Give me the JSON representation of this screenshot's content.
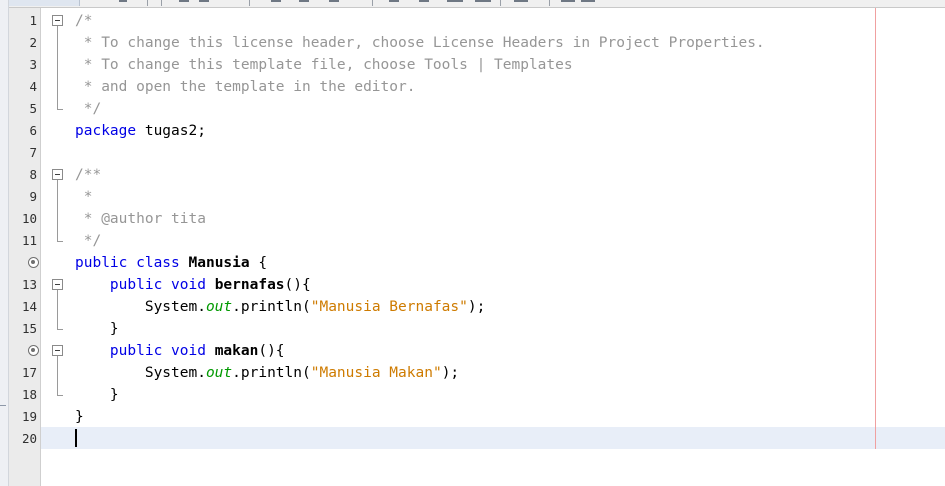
{
  "editor": {
    "line_numbers": [
      "1",
      "2",
      "3",
      "4",
      "5",
      "6",
      "7",
      "8",
      "9",
      "10",
      "11",
      "",
      "13",
      "14",
      "15",
      "",
      "17",
      "18",
      "19",
      "20"
    ],
    "lines": [
      [
        {
          "t": "cm",
          "v": "/*"
        }
      ],
      [
        {
          "t": "cm",
          "v": " * To change this license header, choose License Headers in Project Properties."
        }
      ],
      [
        {
          "t": "cm",
          "v": " * To change this template file, choose Tools | Templates"
        }
      ],
      [
        {
          "t": "cm",
          "v": " * and open the template in the editor."
        }
      ],
      [
        {
          "t": "cm",
          "v": " */"
        }
      ],
      [
        {
          "t": "kw",
          "v": "package"
        },
        {
          "t": "pl",
          "v": " tugas2;"
        }
      ],
      [],
      [
        {
          "t": "cm",
          "v": "/**"
        }
      ],
      [
        {
          "t": "cm",
          "v": " *"
        }
      ],
      [
        {
          "t": "cm",
          "v": " * @author tita"
        }
      ],
      [
        {
          "t": "cm",
          "v": " */"
        }
      ],
      [
        {
          "t": "kw",
          "v": "public class"
        },
        {
          "t": "pl",
          "v": " "
        },
        {
          "t": "cls",
          "v": "Manusia"
        },
        {
          "t": "pl",
          "v": " {"
        }
      ],
      [
        {
          "t": "pl",
          "v": "    "
        },
        {
          "t": "kw",
          "v": "public void"
        },
        {
          "t": "pl",
          "v": " "
        },
        {
          "t": "cls",
          "v": "bernafas"
        },
        {
          "t": "pl",
          "v": "(){"
        }
      ],
      [
        {
          "t": "pl",
          "v": "        System."
        },
        {
          "t": "fld",
          "v": "out"
        },
        {
          "t": "pl",
          "v": ".println("
        },
        {
          "t": "str",
          "v": "\"Manusia Bernafas\""
        },
        {
          "t": "pl",
          "v": ");"
        }
      ],
      [
        {
          "t": "pl",
          "v": "    }"
        }
      ],
      [
        {
          "t": "pl",
          "v": "    "
        },
        {
          "t": "kw",
          "v": "public void"
        },
        {
          "t": "pl",
          "v": " "
        },
        {
          "t": "cls",
          "v": "makan"
        },
        {
          "t": "pl",
          "v": "(){"
        }
      ],
      [
        {
          "t": "pl",
          "v": "        System."
        },
        {
          "t": "fld",
          "v": "out"
        },
        {
          "t": "pl",
          "v": ".println("
        },
        {
          "t": "str",
          "v": "\"Manusia Makan\""
        },
        {
          "t": "pl",
          "v": ");"
        }
      ],
      [
        {
          "t": "pl",
          "v": "    }"
        }
      ],
      [
        {
          "t": "pl",
          "v": "}"
        }
      ],
      []
    ],
    "gutter_marks": [
      12,
      16
    ],
    "fold_regions": [
      [
        1,
        5
      ],
      [
        8,
        11
      ],
      [
        13,
        15
      ],
      [
        16,
        18
      ]
    ],
    "current_line": 20,
    "colors": {
      "keyword": "#0000e6",
      "comment": "#969696",
      "string": "#ce7b00",
      "field": "#009900",
      "current_line": "#e8eef8",
      "margin_line": "#f0a0a0"
    }
  }
}
